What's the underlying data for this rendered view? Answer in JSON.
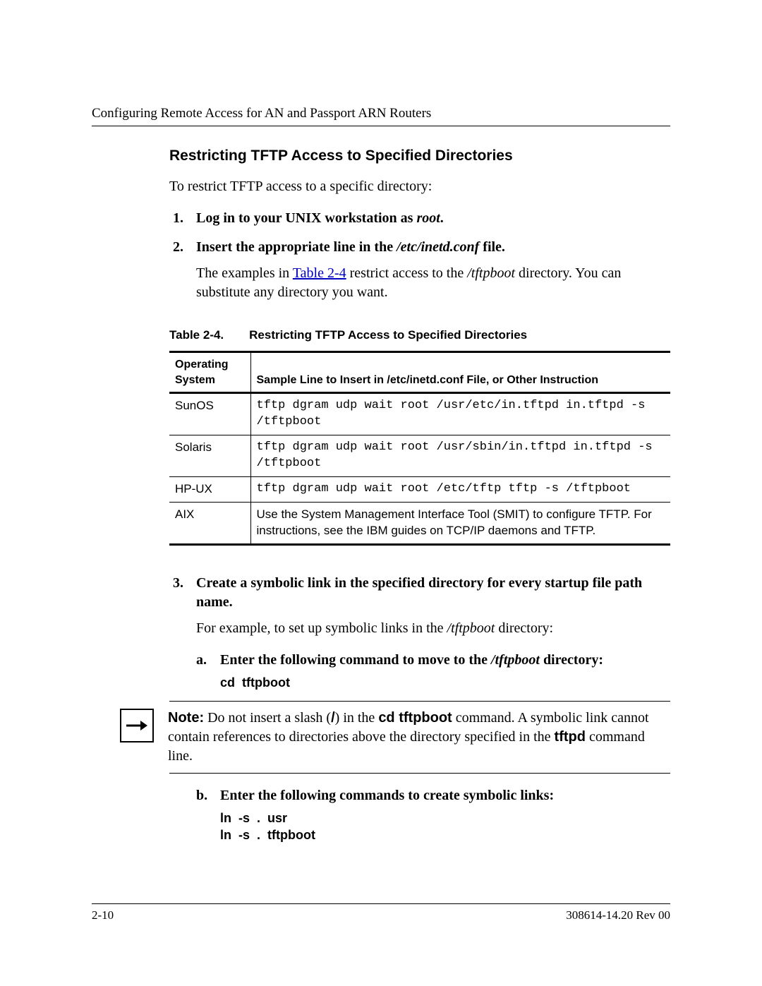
{
  "header": {
    "running_title": "Configuring Remote Access for AN and Passport ARN Routers"
  },
  "section_title": "Restricting TFTP Access to Specified Directories",
  "intro": "To restrict TFTP access to a specific directory:",
  "steps": {
    "s1": {
      "num": "1.",
      "t1": "Log in to your UNIX workstation as ",
      "t2_i": "root",
      "t3": "."
    },
    "s2": {
      "num": "2.",
      "t1": "Insert the appropriate line in the ",
      "t2_i": "/etc/inetd.conf",
      "t3": " file."
    },
    "s2_body": {
      "a": "The examples in ",
      "link": "Table 2-4",
      "b": " restrict access to the ",
      "c_i": "/tftpboot",
      "d": " directory. You can substitute any directory you want."
    },
    "s3": {
      "num": "3.",
      "text": "Create a symbolic link in the specified directory for every startup file path name."
    },
    "s3_body": {
      "a": "For example, to set up symbolic links in the ",
      "b_i": "/tftpboot",
      "c": " directory:"
    },
    "sub_a": {
      "let": "a.",
      "t1": "Enter the following command to move to the ",
      "t2_i": "/tftpboot",
      "t3": " directory:"
    },
    "cmd_a": "cd  tftpboot",
    "sub_b": {
      "let": "b.",
      "text": "Enter the following commands to create symbolic links:"
    },
    "cmd_b1": "ln  -s  .  usr",
    "cmd_b2": "ln  -s  .  tftpboot"
  },
  "table": {
    "caption_num": "Table 2-4.",
    "caption_title": "Restricting TFTP Access to Specified Directories",
    "head_os": "Operating System",
    "head_line": "Sample Line to Insert in /etc/inetd.conf File, or Other Instruction",
    "rows": [
      {
        "os": "SunOS",
        "cell": "tftp dgram udp wait root /usr/etc/in.tftpd in.tftpd -s /tftpboot",
        "mono": true
      },
      {
        "os": "Solaris",
        "cell": "tftp dgram udp wait root /usr/sbin/in.tftpd in.tftpd -s /tftpboot",
        "mono": true
      },
      {
        "os": "HP-UX",
        "cell": "tftp dgram udp wait root /etc/tftp tftp -s /tftpboot",
        "mono": true
      },
      {
        "os": "AIX",
        "cell": "Use the System Management Interface Tool (SMIT) to configure TFTP. For instructions, see the IBM guides on TCP/IP daemons and TFTP.",
        "mono": false
      }
    ]
  },
  "note": {
    "bold1": "Note:",
    "a": " Do not insert a slash (",
    "slash_b": "/",
    "b": ") in the ",
    "cmd_b": "cd tftpboot",
    "c": " command. A symbolic link cannot contain references to directories above the directory specified in the ",
    "tftpd_b": "tftpd",
    "d": " command line."
  },
  "footer": {
    "page": "2-10",
    "doc": "308614-14.20 Rev 00"
  }
}
